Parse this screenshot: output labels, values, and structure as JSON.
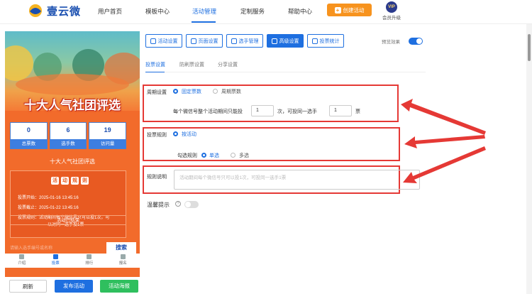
{
  "header": {
    "logo_text": "壹云微",
    "nav": [
      "用户首页",
      "模板中心",
      "活动管理",
      "定制服务",
      "帮助中心"
    ],
    "active_nav": "活动管理",
    "create_label": "创建活动",
    "vip_badge": "VIP",
    "vip_label": "会员升级"
  },
  "phone": {
    "banner_title": "十大人气社团评选",
    "stats": [
      {
        "value": "0",
        "label": "总票数"
      },
      {
        "value": "6",
        "label": "选手数"
      },
      {
        "value": "19",
        "label": "访问量"
      }
    ],
    "org_name": "十大人气社团评选",
    "rules_title": [
      "活",
      "动",
      "规",
      "则"
    ],
    "rule_lines": [
      "投票开始：2025-01-16 13:45:16",
      "投票截止：2025-01-22 13:45:16",
      "投票规则：活动期间每个微信号只可以投1次，可",
      "以对同一选手投1票"
    ],
    "ended_label": "活动已结束",
    "search_placeholder": "请输入选手编号或名称",
    "search_button": "搜索",
    "tabs": [
      "介绍",
      "投票",
      "排行",
      "报名"
    ],
    "active_tab": "投票"
  },
  "bottom_buttons": {
    "refresh": "刷新",
    "publish": "发布活动",
    "poster": "活动海报"
  },
  "toolbar": {
    "buttons": [
      "活动设置",
      "页面设置",
      "选手管理",
      "高级设置",
      "投票统计"
    ],
    "active": "高级设置",
    "preview_label": "预览效果"
  },
  "subtabs": {
    "items": [
      "投票设置",
      "防刷票设置",
      "分享设置"
    ],
    "active": "投票设置"
  },
  "form": {
    "cycle_label": "周期设置",
    "cycle_fixed": "固定票数",
    "cycle_periodic": "周期票数",
    "cycle_text_prefix": "每个微信号整个活动期间只能投",
    "cycle_times": "1",
    "cycle_text_mid": "次，可投同一选手",
    "cycle_votes": "1",
    "cycle_text_suffix": "票",
    "rule_label": "投票规则",
    "rule_option": "按活动",
    "check_label": "勾选规则",
    "check_single": "单选",
    "check_multi": "多选",
    "desc_label": "规则说明",
    "desc_placeholder": "活动期间每个微信号只可以投1次，可投同一选手1票",
    "tip_label": "温馨提示",
    "help_glyph": "?"
  },
  "colors": {
    "accent": "#1e6fe0",
    "highlight": "#e53935",
    "orange": "#f7931e"
  }
}
